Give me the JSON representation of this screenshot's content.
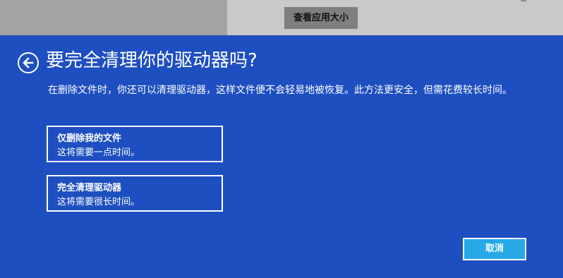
{
  "background": {
    "button_label": "查看应用大小"
  },
  "dialog": {
    "back_icon": "arrow-left-circle-icon",
    "title": "要完全清理你的驱动器吗?",
    "description": "在删除文件时，你还可以清理驱动器，这样文件便不会轻易地被恢复。此方法更安全，但需花费较长时间。",
    "options": [
      {
        "title": "仅删除我的文件",
        "subtitle": "这将需要一点时间。"
      },
      {
        "title": "完全清理驱动器",
        "subtitle": "这将需要很长时间。"
      }
    ],
    "cancel_label": "取消"
  },
  "colors": {
    "dialog_background": "#1e4fc0",
    "cancel_button": "#27a9e8",
    "backdrop": "#a3a3a3"
  }
}
